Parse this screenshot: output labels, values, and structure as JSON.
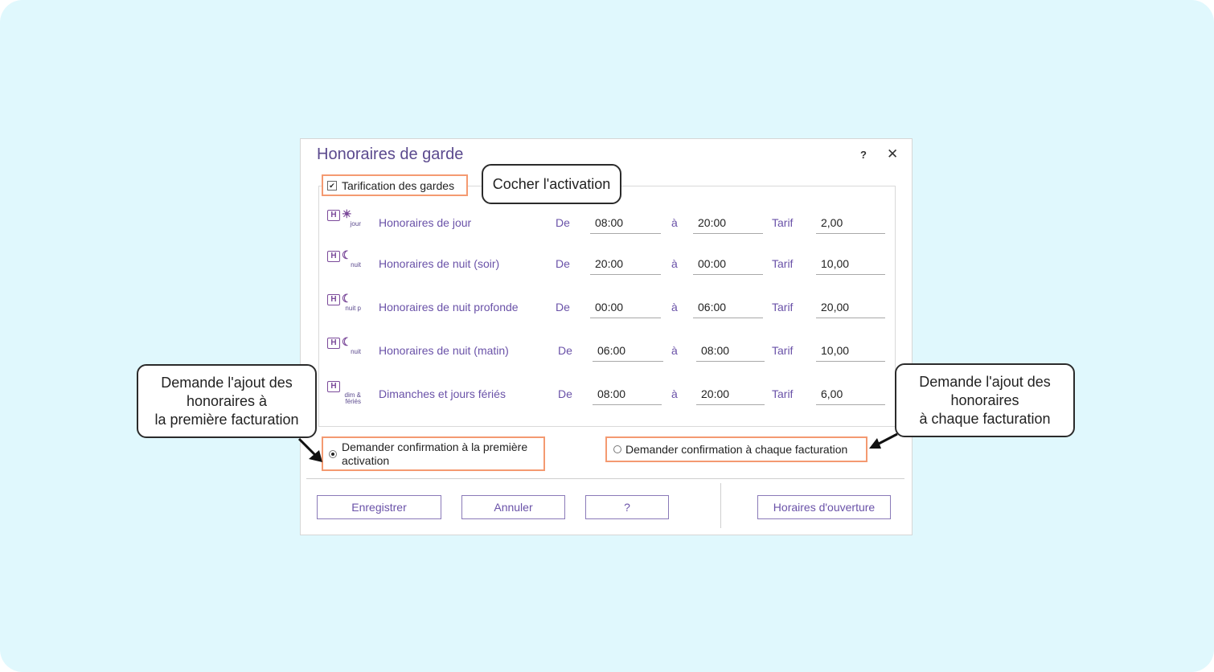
{
  "dialog": {
    "title": "Honoraires de garde",
    "help_glyph": "?",
    "close_glyph": "✕",
    "tarification_checkbox": {
      "label": "Tarification des gardes",
      "checked": true
    }
  },
  "rows": [
    {
      "icon": "day-sun-icon",
      "icon_letter": "H",
      "icon_symbol": "☀",
      "icon_caption": "jour",
      "label": "Honoraires de jour",
      "de_label": "De",
      "from": "08:00",
      "a_label": "à",
      "to": "20:00",
      "tarif_label": "Tarif",
      "tarif": "2,00"
    },
    {
      "icon": "night-moon-icon",
      "icon_letter": "H",
      "icon_symbol": "☾",
      "icon_caption": "nuit",
      "label": "Honoraires de nuit (soir)",
      "de_label": "De",
      "from": "20:00",
      "a_label": "à",
      "to": "00:00",
      "tarif_label": "Tarif",
      "tarif": "10,00"
    },
    {
      "icon": "deep-night-moon-icon",
      "icon_letter": "H",
      "icon_symbol": "☾",
      "icon_caption": "nuit p",
      "label": "Honoraires de nuit profonde",
      "de_label": "De",
      "from": "00:00",
      "a_label": "à",
      "to": "06:00",
      "tarif_label": "Tarif",
      "tarif": "20,00"
    },
    {
      "icon": "night-moon-icon",
      "icon_letter": "H",
      "icon_symbol": "☾",
      "icon_caption": "nuit",
      "label": "Honoraires de nuit (matin)",
      "de_label": "De",
      "from": "06:00",
      "a_label": "à",
      "to": "08:00",
      "tarif_label": "Tarif",
      "tarif": "10,00"
    },
    {
      "icon": "sunday-holiday-icon",
      "icon_letter": "H",
      "icon_symbol": "",
      "icon_caption": "dim & fériés",
      "label": "Dimanches et jours fériés",
      "de_label": "De",
      "from": "08:00",
      "a_label": "à",
      "to": "20:00",
      "tarif_label": "Tarif",
      "tarif": "6,00"
    }
  ],
  "options": {
    "first_activation": {
      "label": "Demander confirmation à la première activation",
      "selected": true
    },
    "each_billing": {
      "label": "Demander confirmation à chaque facturation",
      "selected": false
    }
  },
  "buttons": {
    "save": "Enregistrer",
    "cancel": "Annuler",
    "help": "?",
    "opening_hours": "Horaires d'ouverture"
  },
  "callouts": {
    "activation": "Cocher l'activation",
    "first_billing": [
      "Demande l'ajout des",
      "honoraires à",
      "la première facturation"
    ],
    "each_billing": [
      "Demande l'ajout des",
      "honoraires",
      "à chaque facturation"
    ]
  },
  "colors": {
    "background": "#e0f8fd",
    "accent_text": "#6a52a8",
    "title": "#5b4a8e",
    "highlight_border": "#f49a71",
    "icon": "#7b4a9a"
  }
}
